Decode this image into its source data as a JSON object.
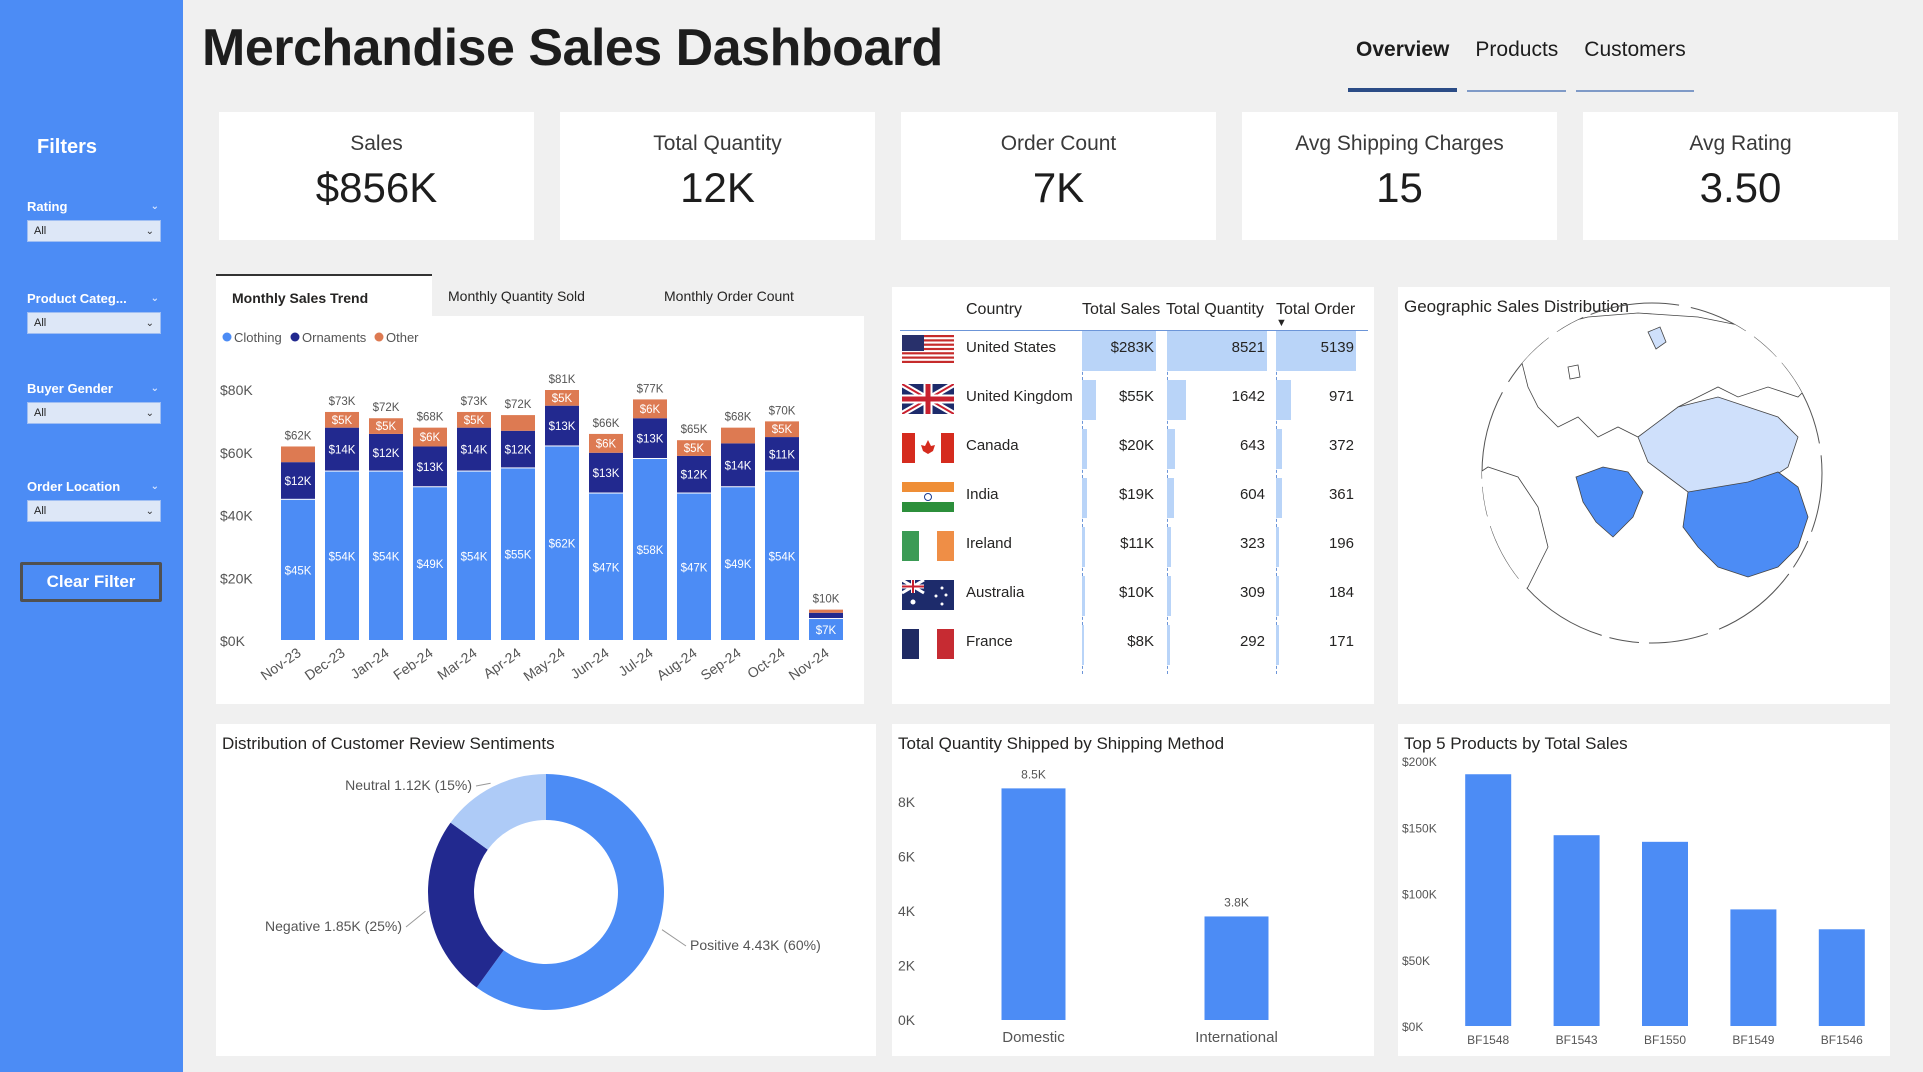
{
  "title": "Merchandise Sales Dashboard",
  "nav_tabs": [
    "Overview",
    "Products",
    "Customers"
  ],
  "sidebar": {
    "title": "Filters",
    "filters": [
      {
        "label": "Rating",
        "value": "All"
      },
      {
        "label": "Product Categ...",
        "value": "All"
      },
      {
        "label": "Buyer Gender",
        "value": "All"
      },
      {
        "label": "Order Location",
        "value": "All"
      }
    ],
    "clear_label": "Clear Filter"
  },
  "kpis": [
    {
      "label": "Sales",
      "value": "$856K"
    },
    {
      "label": "Total Quantity",
      "value": "12K"
    },
    {
      "label": "Order Count",
      "value": "7K"
    },
    {
      "label": "Avg Shipping Charges",
      "value": "15"
    },
    {
      "label": "Avg Rating",
      "value": "3.50"
    }
  ],
  "monthly_tabs": [
    "Monthly Sales Trend",
    "Monthly Quantity Sold",
    "Monthly Order Count"
  ],
  "table": {
    "headers": [
      "Country",
      "Total Sales",
      "Total Quantity",
      "Total Order"
    ],
    "rows": [
      {
        "country": "United States",
        "flag": "us-flag",
        "sales": "$283K",
        "sales_v": 283,
        "qty": "8521",
        "qty_v": 8521,
        "orders": "5139",
        "orders_v": 5139
      },
      {
        "country": "United Kingdom",
        "flag": "uk-flag",
        "sales": "$55K",
        "sales_v": 55,
        "qty": "1642",
        "qty_v": 1642,
        "orders": "971",
        "orders_v": 971
      },
      {
        "country": "Canada",
        "flag": "canada-flag",
        "sales": "$20K",
        "sales_v": 20,
        "qty": "643",
        "qty_v": 643,
        "orders": "372",
        "orders_v": 372
      },
      {
        "country": "India",
        "flag": "india-flag",
        "sales": "$19K",
        "sales_v": 19,
        "qty": "604",
        "qty_v": 604,
        "orders": "361",
        "orders_v": 361
      },
      {
        "country": "Ireland",
        "flag": "ireland-flag",
        "sales": "$11K",
        "sales_v": 11,
        "qty": "323",
        "qty_v": 323,
        "orders": "196",
        "orders_v": 196
      },
      {
        "country": "Australia",
        "flag": "australia-flag",
        "sales": "$10K",
        "sales_v": 10,
        "qty": "309",
        "qty_v": 309,
        "orders": "184",
        "orders_v": 184
      },
      {
        "country": "France",
        "flag": "france-flag",
        "sales": "$8K",
        "sales_v": 8,
        "qty": "292",
        "qty_v": 292,
        "orders": "171",
        "orders_v": 171
      }
    ]
  },
  "globe": {
    "title": "Geographic Sales Distribution"
  },
  "colors": {
    "clothing": "#4c8cf5",
    "ornaments": "#22298f",
    "other": "#dd7a52",
    "light": "#aecbf7"
  },
  "chart_data": [
    {
      "id": "monthly-sales",
      "type": "bar",
      "stacked": true,
      "categories": [
        "Nov-23",
        "Dec-23",
        "Jan-24",
        "Feb-24",
        "Mar-24",
        "Apr-24",
        "May-24",
        "Jun-24",
        "Jul-24",
        "Aug-24",
        "Sep-24",
        "Oct-24",
        "Nov-24"
      ],
      "series": [
        {
          "name": "Clothing",
          "values": [
            45,
            54,
            54,
            49,
            54,
            55,
            62,
            47,
            58,
            47,
            49,
            54,
            7
          ],
          "labels": [
            "$45K",
            "$54K",
            "$54K",
            "$49K",
            "$54K",
            "$55K",
            "$62K",
            "$47K",
            "$58K",
            "$47K",
            "$49K",
            "$54K",
            "$7K"
          ]
        },
        {
          "name": "Ornaments",
          "values": [
            12,
            14,
            12,
            13,
            14,
            12,
            13,
            13,
            13,
            12,
            14,
            11,
            2
          ],
          "labels": [
            "$12K",
            "$14K",
            "$12K",
            "$13K",
            "$14K",
            "$12K",
            "$13K",
            "$13K",
            "$13K",
            "$12K",
            "$14K",
            "$11K",
            ""
          ]
        },
        {
          "name": "Other",
          "values": [
            5,
            5,
            5,
            6,
            5,
            5,
            5,
            6,
            6,
            5,
            5,
            5,
            1
          ],
          "labels": [
            "",
            "$5K",
            "$5K",
            "$6K",
            "$5K",
            "",
            "$5K",
            "$6K",
            "$6K",
            "$5K",
            "",
            "$5K",
            ""
          ]
        }
      ],
      "totals": [
        "$62K",
        "$73K",
        "$72K",
        "$68K",
        "$73K",
        "$72K",
        "$81K",
        "$66K",
        "$77K",
        "$65K",
        "$68K",
        "$70K",
        "$10K"
      ],
      "yticks": [
        "$0K",
        "$20K",
        "$40K",
        "$60K",
        "$80K"
      ],
      "ylim": [
        0,
        80
      ]
    },
    {
      "id": "sentiment",
      "type": "pie",
      "donut": true,
      "title": "Distribution of Customer Review Sentiments",
      "slices": [
        {
          "name": "Positive",
          "value": 60,
          "label": "Positive 4.43K (60%)"
        },
        {
          "name": "Negative",
          "value": 25,
          "label": "Negative 1.85K (25%)"
        },
        {
          "name": "Neutral",
          "value": 15,
          "label": "Neutral 1.12K (15%)"
        }
      ]
    },
    {
      "id": "shipping",
      "type": "bar",
      "title": "Total Quantity Shipped by Shipping Method",
      "categories": [
        "Domestic",
        "International"
      ],
      "values": [
        8.5,
        3.8
      ],
      "labels": [
        "8.5K",
        "3.8K"
      ],
      "yticks": [
        "0K",
        "2K",
        "4K",
        "6K",
        "8K"
      ],
      "ylim": [
        0,
        8
      ]
    },
    {
      "id": "top-products",
      "type": "bar",
      "title": "Top 5 Products by Total Sales",
      "categories": [
        "BF1548",
        "BF1543",
        "BF1550",
        "BF1549",
        "BF1546"
      ],
      "values": [
        190,
        144,
        139,
        88,
        73
      ],
      "yticks": [
        "$0K",
        "$50K",
        "$100K",
        "$150K",
        "$200K"
      ],
      "ylim": [
        0,
        200
      ]
    }
  ]
}
